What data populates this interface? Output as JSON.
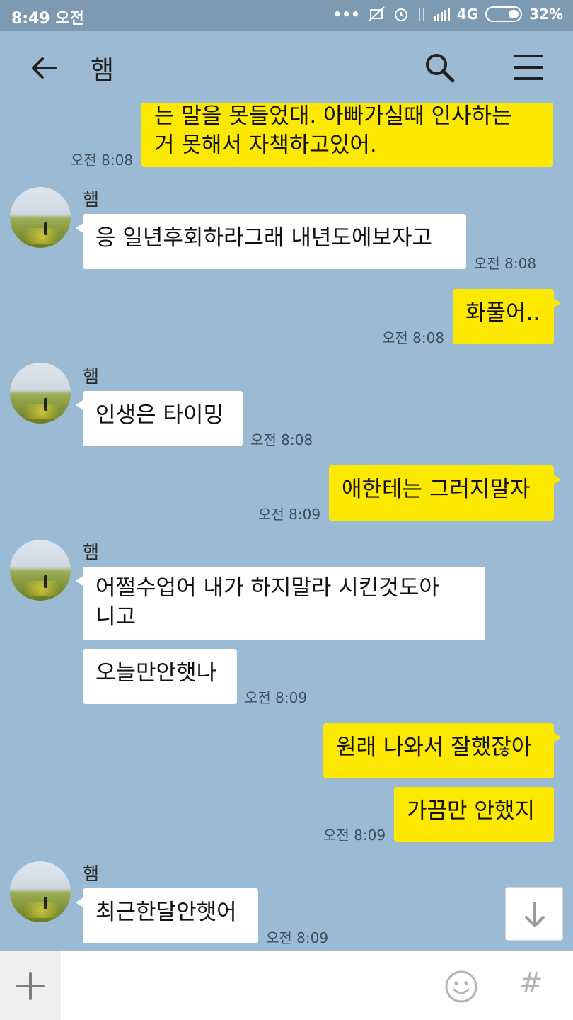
{
  "status_bar": {
    "time": "8:49 오전",
    "network": "4G",
    "battery": "32%"
  },
  "header": {
    "title": "햄"
  },
  "messages": [
    {
      "id": "m0",
      "sender": "me",
      "lines": [
        "는 말을 못들었대. 아빠가실때  인사하는",
        "거 못해서 자책하고있어."
      ],
      "time": "오전 8:08"
    },
    {
      "id": "m1",
      "sender": "them",
      "name": "햄",
      "lines": [
        "응 일년후회하라그래 내년도에보자고"
      ],
      "time": "오전 8:08"
    },
    {
      "id": "m2",
      "sender": "me",
      "lines": [
        "화풀어.."
      ],
      "time": "오전 8:08"
    },
    {
      "id": "m3",
      "sender": "them",
      "name": "햄",
      "lines": [
        "인생은 타이밍"
      ],
      "time": "오전 8:08"
    },
    {
      "id": "m4",
      "sender": "me",
      "lines": [
        "애한테는 그러지말자"
      ],
      "time": "오전 8:09"
    },
    {
      "id": "m5",
      "sender": "them",
      "name": "햄",
      "lines": [
        "어쩔수업어 내가 하지말라 시킨것도아",
        "니고"
      ]
    },
    {
      "id": "m6",
      "sender": "them",
      "lines": [
        "오늘만안햇나"
      ],
      "time": "오전 8:09"
    },
    {
      "id": "m7",
      "sender": "me",
      "lines": [
        "원래 나와서 잘했잖아"
      ]
    },
    {
      "id": "m8",
      "sender": "me",
      "lines": [
        "가끔만 안했지"
      ],
      "time": "오전 8:09"
    },
    {
      "id": "m9",
      "sender": "them",
      "name": "햄",
      "lines": [
        "최근한달안햇어"
      ],
      "time": "오전 8:09"
    }
  ],
  "input": {
    "placeholder": "",
    "plus_label": "+",
    "hash_label": "#"
  },
  "icons": {
    "back": "arrow-left-icon",
    "search": "search-icon",
    "menu": "hamburger-menu-icon",
    "scroll_down": "arrow-down-icon",
    "emoji": "smiley-icon"
  },
  "colors": {
    "chat_bg": "#9bbbd4",
    "my_bubble": "#fde900",
    "their_bubble": "#ffffff"
  }
}
